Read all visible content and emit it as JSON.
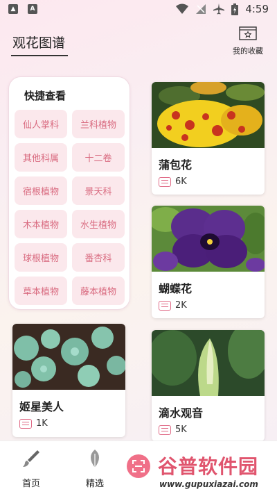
{
  "status_bar": {
    "time": "4:59"
  },
  "header": {
    "title": "观花图谱",
    "favorites_label": "我的收藏"
  },
  "quick_view": {
    "title": "快捷查看",
    "chips": [
      "仙人掌科",
      "兰科植物",
      "其他科属",
      "十二卷",
      "宿根植物",
      "景天科",
      "木本植物",
      "水生植物",
      "球根植物",
      "番杏科",
      "草本植物",
      "藤本植物"
    ]
  },
  "cards": [
    {
      "name": "蒲包花",
      "likes": "6K",
      "photo": "yellow-red-spotted-flower"
    },
    {
      "name": "蝴蝶花",
      "likes": "2K",
      "photo": "purple-pansy"
    },
    {
      "name": "姬星美人",
      "likes": "1K",
      "photo": "green-succulents"
    },
    {
      "name": "滴水观音",
      "likes": "5K",
      "photo": "green-spathe"
    }
  ],
  "bottom_nav": {
    "items": [
      {
        "label": "首页",
        "icon": "brush-icon"
      },
      {
        "label": "精选",
        "icon": "leaf-icon"
      }
    ],
    "scan_icon": "scan-icon"
  },
  "watermark": {
    "title": "谷普软件园",
    "url": "www.gupuxiazai.com"
  },
  "colors": {
    "accent": "#e06a86",
    "chip_bg": "#fbe8ec",
    "chip_text": "#d96b80"
  }
}
